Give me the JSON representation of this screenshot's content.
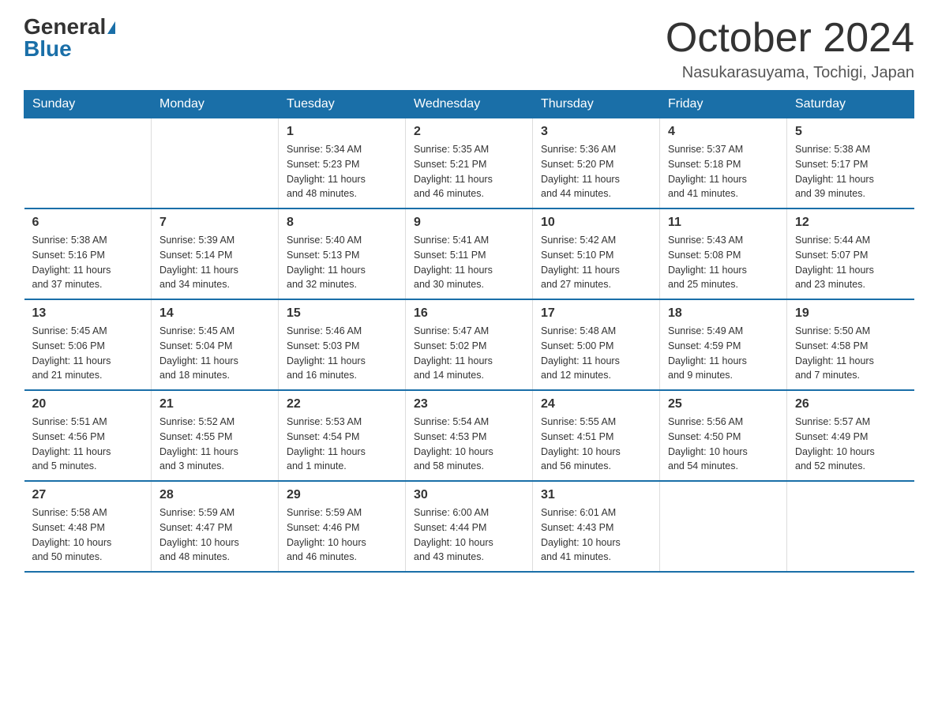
{
  "logo": {
    "general": "General",
    "blue": "Blue"
  },
  "title": "October 2024",
  "location": "Nasukarasuyama, Tochigi, Japan",
  "days_of_week": [
    "Sunday",
    "Monday",
    "Tuesday",
    "Wednesday",
    "Thursday",
    "Friday",
    "Saturday"
  ],
  "weeks": [
    [
      {
        "day": "",
        "info": ""
      },
      {
        "day": "",
        "info": ""
      },
      {
        "day": "1",
        "info": "Sunrise: 5:34 AM\nSunset: 5:23 PM\nDaylight: 11 hours\nand 48 minutes."
      },
      {
        "day": "2",
        "info": "Sunrise: 5:35 AM\nSunset: 5:21 PM\nDaylight: 11 hours\nand 46 minutes."
      },
      {
        "day": "3",
        "info": "Sunrise: 5:36 AM\nSunset: 5:20 PM\nDaylight: 11 hours\nand 44 minutes."
      },
      {
        "day": "4",
        "info": "Sunrise: 5:37 AM\nSunset: 5:18 PM\nDaylight: 11 hours\nand 41 minutes."
      },
      {
        "day": "5",
        "info": "Sunrise: 5:38 AM\nSunset: 5:17 PM\nDaylight: 11 hours\nand 39 minutes."
      }
    ],
    [
      {
        "day": "6",
        "info": "Sunrise: 5:38 AM\nSunset: 5:16 PM\nDaylight: 11 hours\nand 37 minutes."
      },
      {
        "day": "7",
        "info": "Sunrise: 5:39 AM\nSunset: 5:14 PM\nDaylight: 11 hours\nand 34 minutes."
      },
      {
        "day": "8",
        "info": "Sunrise: 5:40 AM\nSunset: 5:13 PM\nDaylight: 11 hours\nand 32 minutes."
      },
      {
        "day": "9",
        "info": "Sunrise: 5:41 AM\nSunset: 5:11 PM\nDaylight: 11 hours\nand 30 minutes."
      },
      {
        "day": "10",
        "info": "Sunrise: 5:42 AM\nSunset: 5:10 PM\nDaylight: 11 hours\nand 27 minutes."
      },
      {
        "day": "11",
        "info": "Sunrise: 5:43 AM\nSunset: 5:08 PM\nDaylight: 11 hours\nand 25 minutes."
      },
      {
        "day": "12",
        "info": "Sunrise: 5:44 AM\nSunset: 5:07 PM\nDaylight: 11 hours\nand 23 minutes."
      }
    ],
    [
      {
        "day": "13",
        "info": "Sunrise: 5:45 AM\nSunset: 5:06 PM\nDaylight: 11 hours\nand 21 minutes."
      },
      {
        "day": "14",
        "info": "Sunrise: 5:45 AM\nSunset: 5:04 PM\nDaylight: 11 hours\nand 18 minutes."
      },
      {
        "day": "15",
        "info": "Sunrise: 5:46 AM\nSunset: 5:03 PM\nDaylight: 11 hours\nand 16 minutes."
      },
      {
        "day": "16",
        "info": "Sunrise: 5:47 AM\nSunset: 5:02 PM\nDaylight: 11 hours\nand 14 minutes."
      },
      {
        "day": "17",
        "info": "Sunrise: 5:48 AM\nSunset: 5:00 PM\nDaylight: 11 hours\nand 12 minutes."
      },
      {
        "day": "18",
        "info": "Sunrise: 5:49 AM\nSunset: 4:59 PM\nDaylight: 11 hours\nand 9 minutes."
      },
      {
        "day": "19",
        "info": "Sunrise: 5:50 AM\nSunset: 4:58 PM\nDaylight: 11 hours\nand 7 minutes."
      }
    ],
    [
      {
        "day": "20",
        "info": "Sunrise: 5:51 AM\nSunset: 4:56 PM\nDaylight: 11 hours\nand 5 minutes."
      },
      {
        "day": "21",
        "info": "Sunrise: 5:52 AM\nSunset: 4:55 PM\nDaylight: 11 hours\nand 3 minutes."
      },
      {
        "day": "22",
        "info": "Sunrise: 5:53 AM\nSunset: 4:54 PM\nDaylight: 11 hours\nand 1 minute."
      },
      {
        "day": "23",
        "info": "Sunrise: 5:54 AM\nSunset: 4:53 PM\nDaylight: 10 hours\nand 58 minutes."
      },
      {
        "day": "24",
        "info": "Sunrise: 5:55 AM\nSunset: 4:51 PM\nDaylight: 10 hours\nand 56 minutes."
      },
      {
        "day": "25",
        "info": "Sunrise: 5:56 AM\nSunset: 4:50 PM\nDaylight: 10 hours\nand 54 minutes."
      },
      {
        "day": "26",
        "info": "Sunrise: 5:57 AM\nSunset: 4:49 PM\nDaylight: 10 hours\nand 52 minutes."
      }
    ],
    [
      {
        "day": "27",
        "info": "Sunrise: 5:58 AM\nSunset: 4:48 PM\nDaylight: 10 hours\nand 50 minutes."
      },
      {
        "day": "28",
        "info": "Sunrise: 5:59 AM\nSunset: 4:47 PM\nDaylight: 10 hours\nand 48 minutes."
      },
      {
        "day": "29",
        "info": "Sunrise: 5:59 AM\nSunset: 4:46 PM\nDaylight: 10 hours\nand 46 minutes."
      },
      {
        "day": "30",
        "info": "Sunrise: 6:00 AM\nSunset: 4:44 PM\nDaylight: 10 hours\nand 43 minutes."
      },
      {
        "day": "31",
        "info": "Sunrise: 6:01 AM\nSunset: 4:43 PM\nDaylight: 10 hours\nand 41 minutes."
      },
      {
        "day": "",
        "info": ""
      },
      {
        "day": "",
        "info": ""
      }
    ]
  ]
}
